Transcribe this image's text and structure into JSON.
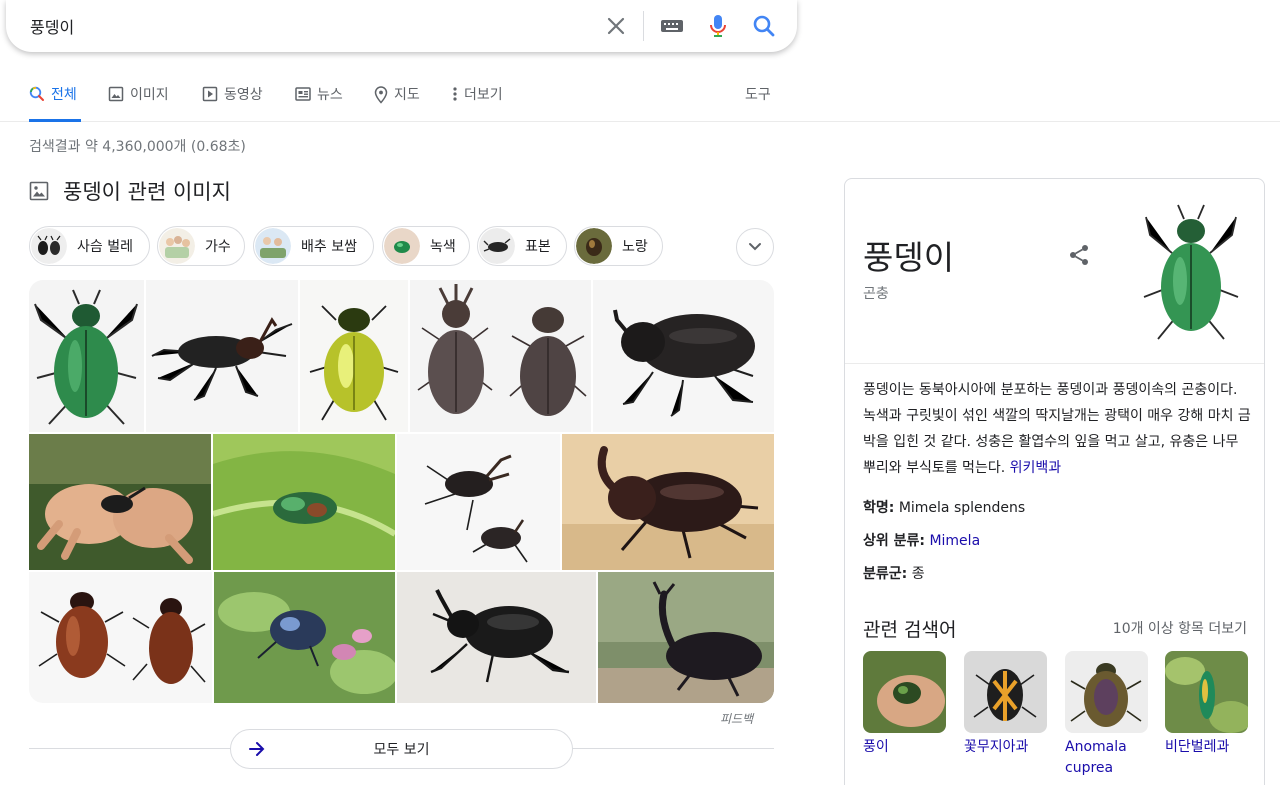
{
  "search": {
    "query": "풍뎅이",
    "icons": [
      "close-icon",
      "keyboard-icon",
      "microphone-icon",
      "search-icon"
    ]
  },
  "tabs": [
    {
      "label": "전체",
      "icon": "search-icon",
      "active": true
    },
    {
      "label": "이미지",
      "icon": "image-icon"
    },
    {
      "label": "동영상",
      "icon": "video-icon"
    },
    {
      "label": "뉴스",
      "icon": "news-icon"
    },
    {
      "label": "지도",
      "icon": "map-pin-icon"
    },
    {
      "label": "더보기",
      "icon": "more-vert-icon"
    }
  ],
  "tools_label": "도구",
  "result_stats": "검색결과 약 4,360,000개 (0.68초)",
  "images_section": {
    "title": "풍뎅이 관련 이미지",
    "chips": [
      "사슴 벌레",
      "가수",
      "배추 보쌈",
      "녹색",
      "표본",
      "노랑"
    ],
    "feedback": "피드백",
    "show_all": "모두 보기"
  },
  "knowledge_panel": {
    "title": "풍뎅이",
    "subtitle": "곤충",
    "description": "풍뎅이는 동북아시아에 분포하는 풍뎅이과 풍뎅이속의 곤충이다. 녹색과 구릿빛이 섞인 색깔의 딱지날개는 광택이 매우 강해 마치 금박을 입힌 것 같다. 성충은 활엽수의 잎을 먹고 살고, 유충은 나무뿌리와 부식토를 먹는다.",
    "source": "위키백과",
    "facts": [
      {
        "label": "학명:",
        "value": "Mimela splendens",
        "link": false
      },
      {
        "label": "상위 분류:",
        "value": "Mimela",
        "link": true
      },
      {
        "label": "분류군:",
        "value": "종",
        "link": false
      }
    ],
    "related_title": "관련 검색어",
    "related_more": "10개 이상 항목 더보기",
    "related": [
      "풍이",
      "꽃무지아과",
      "Anomala cuprea",
      "비단벌레과"
    ]
  },
  "colors": {
    "accent": "#1a73e8",
    "link": "#1a0dab",
    "secondary_text": "#70757a"
  }
}
